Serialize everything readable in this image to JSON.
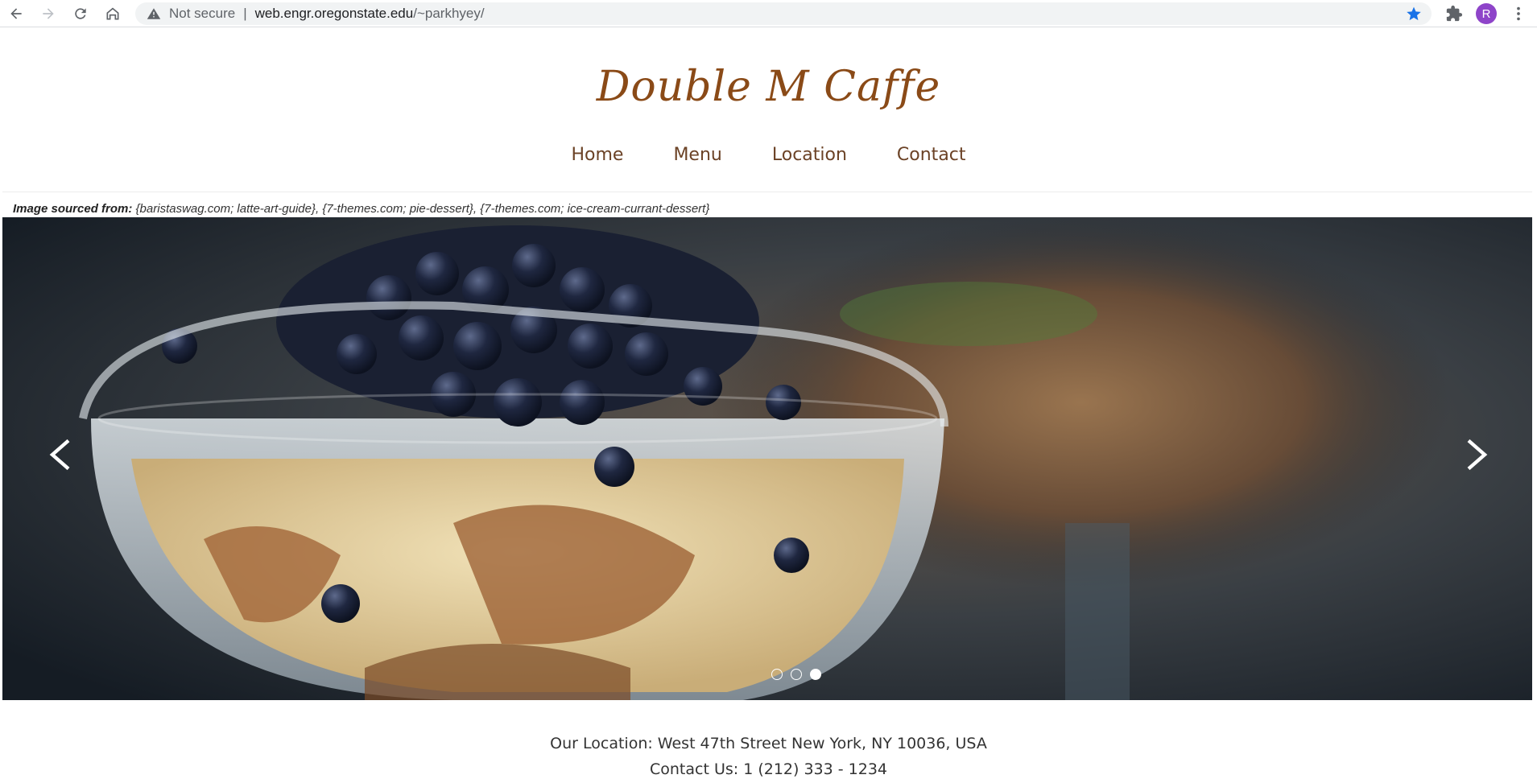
{
  "browser": {
    "security_label": "Not secure",
    "url_host": "web.engr.oregonstate.edu",
    "url_path": "/~parkhyey/",
    "profile_initial": "R"
  },
  "site": {
    "title": "Double M Caffe",
    "nav": [
      "Home",
      "Menu",
      "Location",
      "Contact"
    ]
  },
  "credit": {
    "label": "Image sourced from:",
    "text": " {baristaswag.com; latte-art-guide}, {7-themes.com; pie-dessert}, {7-themes.com; ice-cream-currant-dessert}"
  },
  "carousel": {
    "slide_count": 3,
    "active_index": 2
  },
  "footer": {
    "location": "Our Location: West 47th Street New York, NY 10036, USA",
    "contact": "Contact Us: 1 (212) 333 - 1234"
  },
  "colors": {
    "title": "#8a4a17",
    "nav": "#6b4226",
    "star": "#1a73e8",
    "avatar": "#8e44c9"
  }
}
